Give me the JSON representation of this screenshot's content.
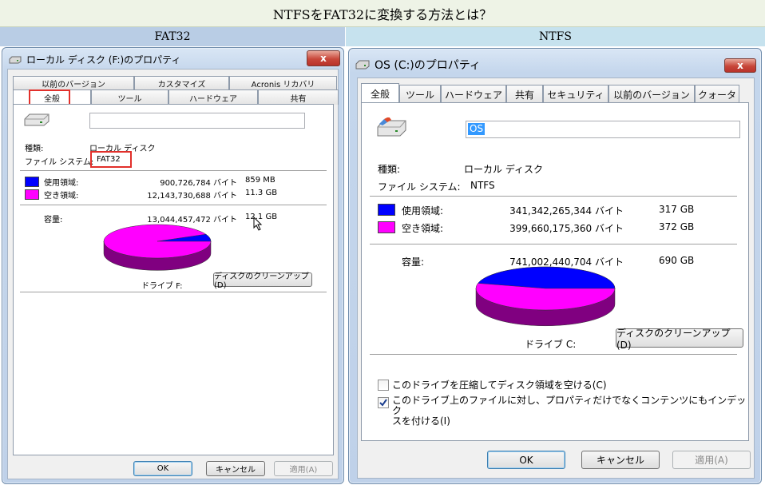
{
  "page_title": "NTFSをFAT32に変換する方法とは？",
  "columns": {
    "left": "FAT32",
    "right": "NTFS"
  },
  "colors": {
    "used": "#0000ff",
    "free": "#ff00ff",
    "used_side": "#000080",
    "free_side": "#800080"
  },
  "fat32": {
    "window_title": "ローカル ディスク (F:)のプロパティ",
    "close_label": "x",
    "tabs_top": [
      "以前のバージョン",
      "カスタマイズ",
      "Acronis リカバリ"
    ],
    "tabs_bottom": [
      "全般",
      "ツール",
      "ハードウェア",
      "共有"
    ],
    "name_value": "",
    "type_label": "種類:",
    "type_value": "ローカル ディスク",
    "fs_label": "ファイル システム:",
    "fs_value": "FAT32",
    "used_label": "使用領域:",
    "used_bytes": "900,726,784 バイト",
    "used_size": "859 MB",
    "used_fraction": 0.069,
    "free_label": "空き領域:",
    "free_bytes": "12,143,730,688 バイト",
    "free_size": "11.3 GB",
    "cap_label": "容量:",
    "cap_bytes": "13,044,457,472 バイト",
    "cap_size": "12.1 GB",
    "drive_label": "ドライブ F:",
    "cleanup_label": "ディスクのクリーンアップ(D)",
    "ok_label": "OK",
    "cancel_label": "キャンセル",
    "apply_label": "適用(A)"
  },
  "ntfs": {
    "window_title": "OS (C:)のプロパティ",
    "close_label": "x",
    "tabs": [
      "全般",
      "ツール",
      "ハードウェア",
      "共有",
      "セキュリティ",
      "以前のバージョン",
      "クォータ"
    ],
    "name_value": "OS",
    "type_label": "種類:",
    "type_value": "ローカル ディスク",
    "fs_label": "ファイル システム:",
    "fs_value": "NTFS",
    "used_label": "使用領域:",
    "used_bytes": "341,342,265,344 バイト",
    "used_size": "317 GB",
    "used_fraction": 0.461,
    "free_label": "空き領域:",
    "free_bytes": "399,660,175,360 バイト",
    "free_size": "372 GB",
    "cap_label": "容量:",
    "cap_bytes": "741,002,440,704 バイト",
    "cap_size": "690 GB",
    "drive_label": "ドライブ C:",
    "cleanup_label": "ディスクのクリーンアップ(D)",
    "compress_label": "このドライブを圧縮してディスク領域を空ける(C)",
    "compress_checked": false,
    "index_label_1": "このドライブ上のファイルに対し、プロパティだけでなくコンテンツにもインデック",
    "index_label_2": "スを付ける(I)",
    "index_checked": true,
    "ok_label": "OK",
    "cancel_label": "キャンセル",
    "apply_label": "適用(A)"
  }
}
